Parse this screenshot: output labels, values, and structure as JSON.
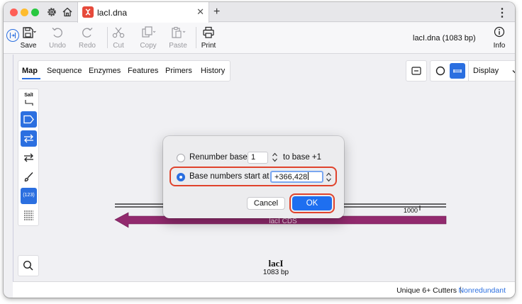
{
  "tab": {
    "title": "lacI.dna",
    "close": "✕"
  },
  "titlebar": {
    "new_tab": "+",
    "more": "⋮"
  },
  "toolbar": {
    "save": "Save",
    "undo": "Undo",
    "redo": "Redo",
    "cut": "Cut",
    "copy": "Copy",
    "paste": "Paste",
    "print": "Print",
    "info": "Info",
    "file_name": "lacI.dna",
    "file_size": "(1083 bp)"
  },
  "view_tabs": [
    "Map",
    "Sequence",
    "Enzymes",
    "Features",
    "Primers",
    "History"
  ],
  "display_menu": {
    "label": "Display"
  },
  "side_tools": {
    "enzyme_label": "SalI",
    "numbers_label": "(123)"
  },
  "map": {
    "name": "lacI",
    "size": "1083 bp",
    "tick_label": "1000",
    "feature_label": "lacI CDS",
    "feature_color": "#922a6e"
  },
  "status": {
    "cutters": "Unique 6+ Cutters",
    "separator": "|",
    "mode": "Nonredundant"
  },
  "dialog": {
    "renumber_label": "Renumber base",
    "renumber_value": "1",
    "renumber_suffix": "to base +1",
    "start_label": "Base numbers start at",
    "start_value": "+366,428",
    "selected": "start",
    "cancel": "Cancel",
    "ok": "OK",
    "highlight_color": "#e0432c",
    "accent_color": "#1e6ff0"
  }
}
